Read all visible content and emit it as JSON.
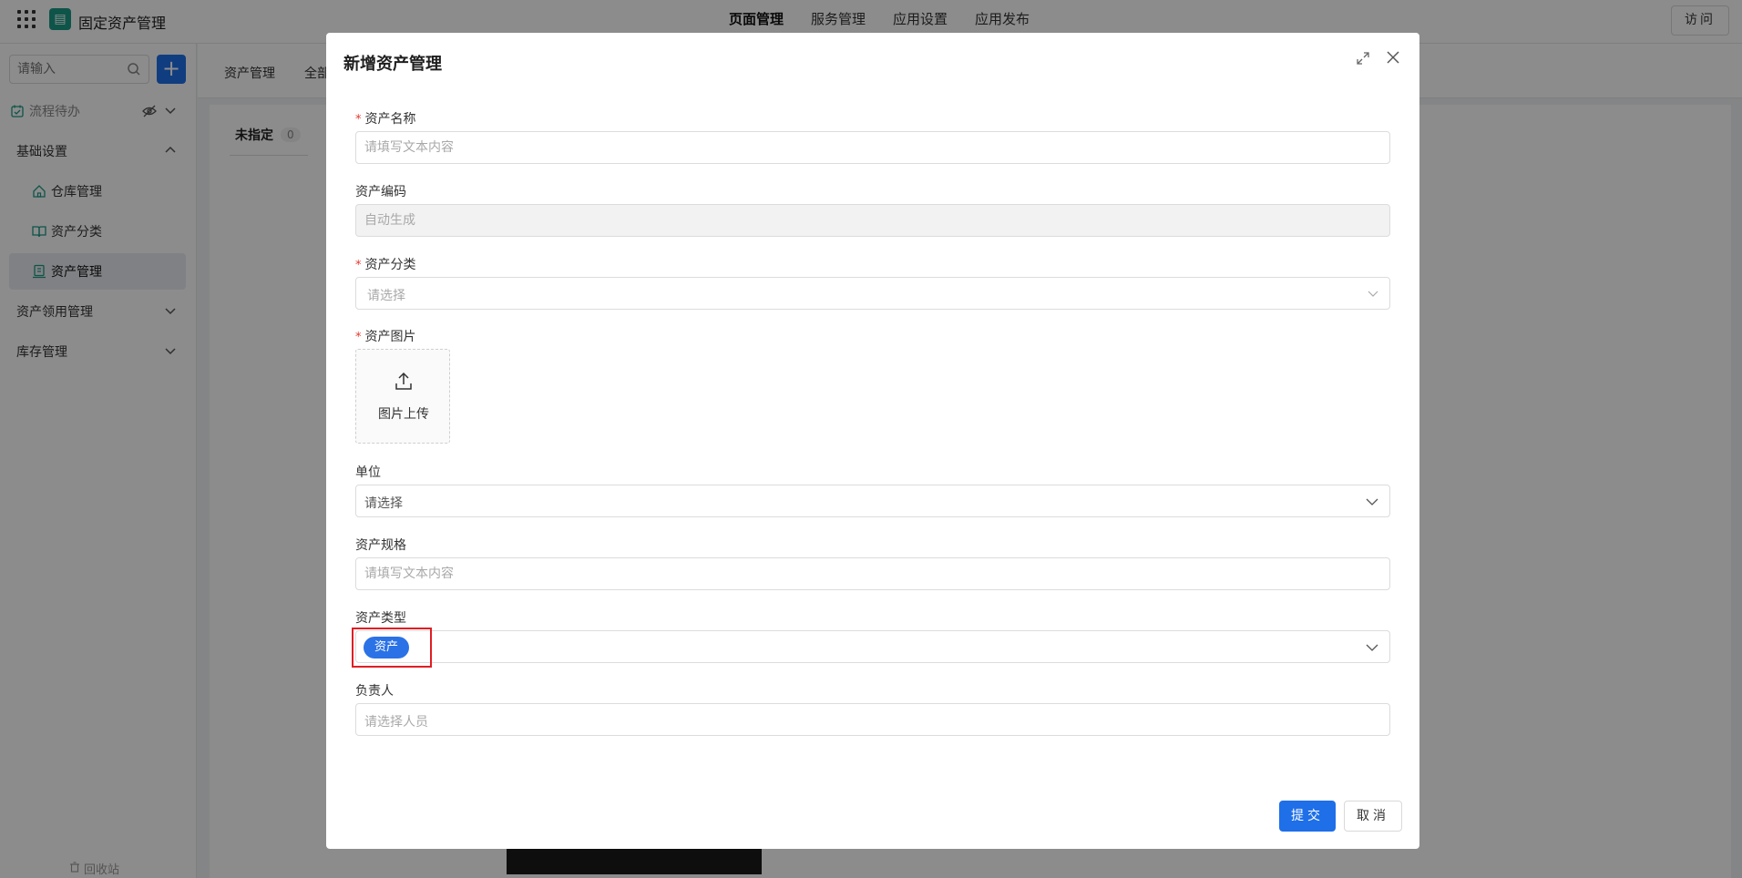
{
  "header": {
    "app_title": "固定资产管理",
    "nav": [
      "页面管理",
      "服务管理",
      "应用设置",
      "应用发布"
    ],
    "active_nav": "页面管理",
    "visit_label": "访问"
  },
  "sidebar": {
    "search_placeholder": "请输入",
    "items": [
      {
        "label": "流程待办"
      },
      {
        "label": "基础设置"
      },
      {
        "label": "仓库管理"
      },
      {
        "label": "资产分类"
      },
      {
        "label": "资产管理"
      },
      {
        "label": "资产领用管理"
      },
      {
        "label": "库存管理"
      }
    ],
    "recycle_label": "回收站"
  },
  "main": {
    "tabs": [
      "资产管理",
      "全部"
    ],
    "group_label": "未指定",
    "group_count": "0"
  },
  "modal": {
    "title": "新增资产管理",
    "fields": {
      "name": {
        "label": "资产名称",
        "placeholder": "请填写文本内容"
      },
      "code": {
        "label": "资产编码",
        "placeholder": "自动生成"
      },
      "category": {
        "label": "资产分类",
        "placeholder": "请选择"
      },
      "image": {
        "label": "资产图片",
        "upload_label": "图片上传"
      },
      "unit": {
        "label": "单位",
        "placeholder": "请选择"
      },
      "spec": {
        "label": "资产规格",
        "placeholder": "请填写文本内容"
      },
      "type": {
        "label": "资产类型",
        "value": "资产"
      },
      "owner": {
        "label": "负责人",
        "placeholder": "请选择人员"
      }
    },
    "submit_label": "提交",
    "cancel_label": "取消"
  },
  "colors": {
    "primary": "#1e6fe8",
    "required": "#e5372c",
    "highlight": "#e01e24",
    "logo": "#1a9a86"
  }
}
